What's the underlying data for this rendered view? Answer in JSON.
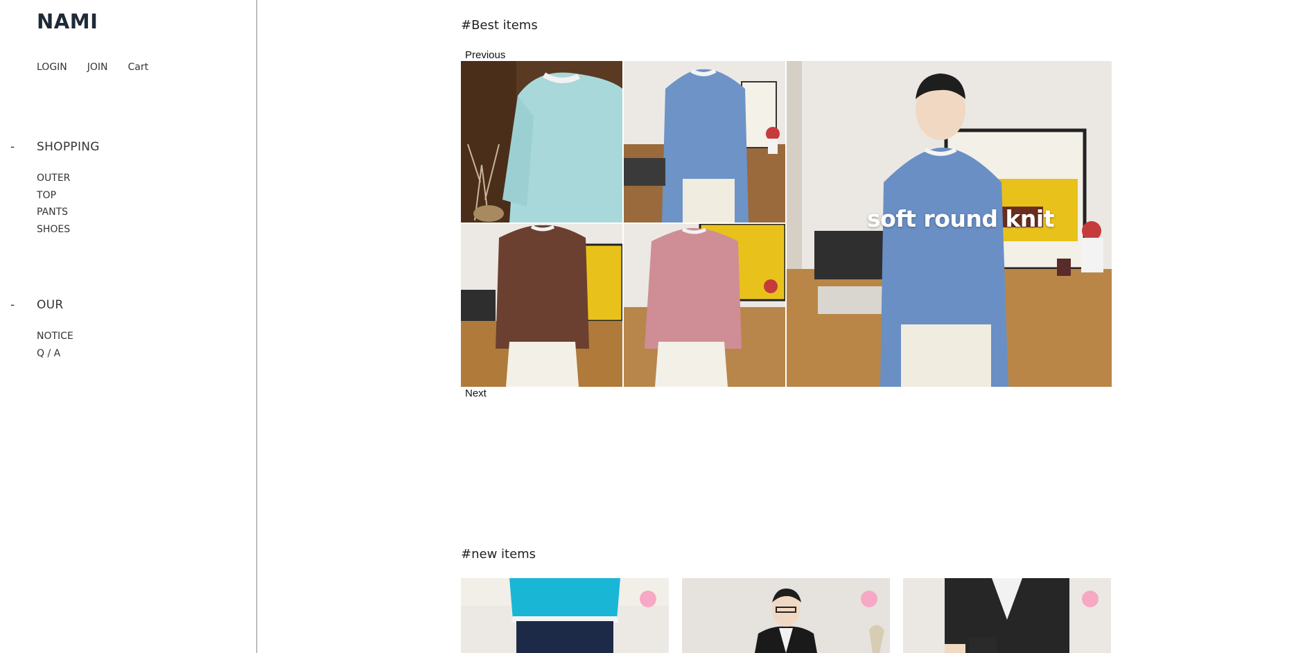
{
  "brand": {
    "logo": "NAMI"
  },
  "top_links": [
    "LOGIN",
    "JOIN",
    "Cart"
  ],
  "sidebar": {
    "shopping": {
      "dash": "-",
      "title": "SHOPPING",
      "items": [
        "OUTER",
        "TOP",
        "PANTS",
        "SHOES"
      ]
    },
    "our": {
      "dash": "-",
      "title": "OUR",
      "items": [
        "NOTICE",
        "Q / A"
      ]
    }
  },
  "best": {
    "heading": "#Best items",
    "previous": "Previous",
    "next": "Next",
    "caption": "soft round knit"
  },
  "new_items": {
    "heading": "#new items"
  },
  "colors": {
    "divider": "#8a8a8a",
    "heart_badge": "#f7a8c4",
    "logo": "#1f2a37"
  }
}
